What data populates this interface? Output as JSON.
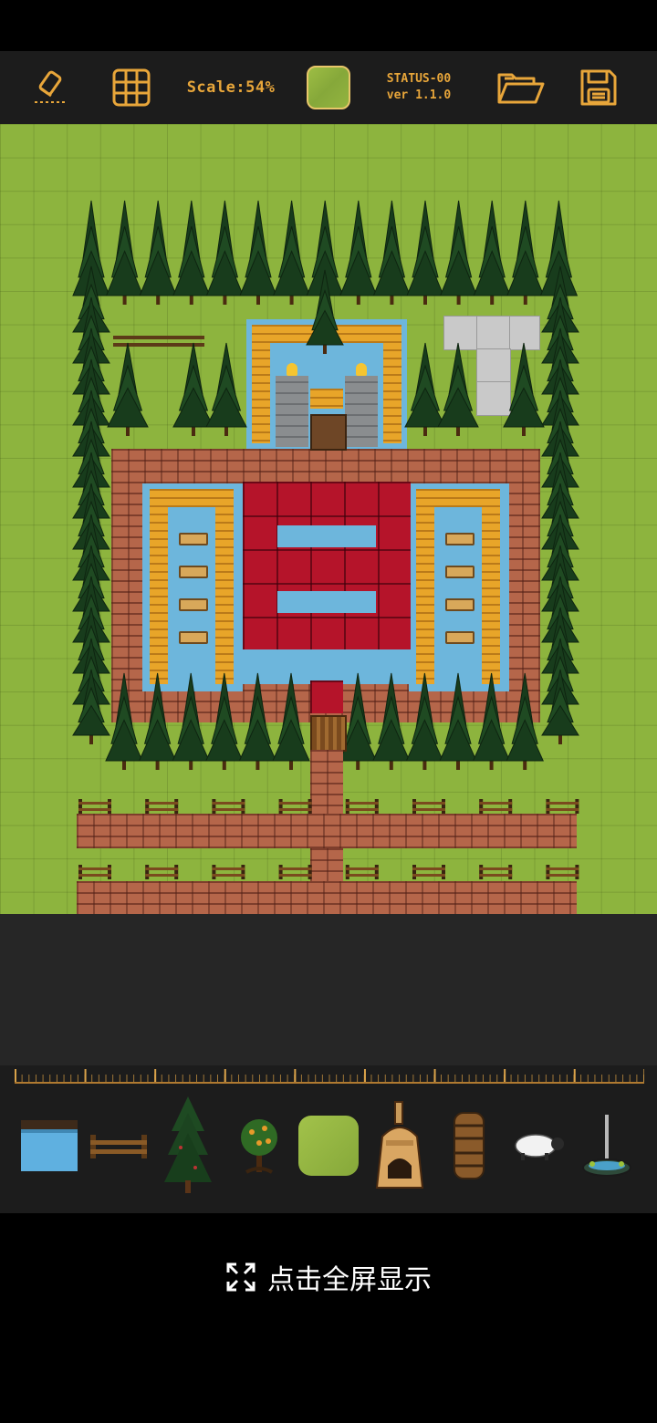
{
  "toolbar": {
    "scale_label": "Scale:54%",
    "status_line1": "STATUS-00",
    "status_line2": "ver 1.1.0",
    "icons": [
      "eraser-icon",
      "grid-icon",
      "current-tile-swatch",
      "folder-open-icon",
      "save-disk-icon"
    ],
    "accent_color": "#e8a63a"
  },
  "map": {
    "ground": "grass",
    "features": [
      "pine-tree-border",
      "brick-courtyard",
      "red-tile-building",
      "water-moat",
      "hay-beds",
      "stone-towers",
      "fence-rows",
      "brick-paths",
      "wooden-gate"
    ]
  },
  "palette": {
    "items": [
      {
        "name": "water-tile"
      },
      {
        "name": "wooden-fence"
      },
      {
        "name": "pine-tree"
      },
      {
        "name": "fruit-tree"
      },
      {
        "name": "grass-tile"
      },
      {
        "name": "kiln"
      },
      {
        "name": "wooden-barrel"
      },
      {
        "name": "sheep"
      },
      {
        "name": "fountain"
      }
    ]
  },
  "fullscreen": {
    "label": "点击全屏显示",
    "icon": "expand-arrows-icon"
  }
}
